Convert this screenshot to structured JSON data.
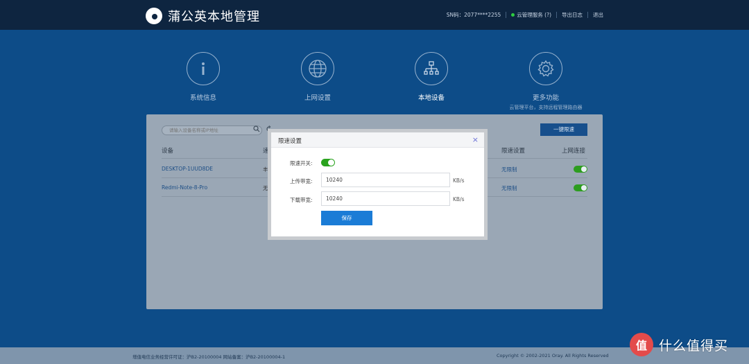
{
  "header": {
    "title": "蒲公英本地管理",
    "sn": "SN码：2077****2255",
    "cloud_status": "云管理服务 (?)",
    "export_log": "导出日志",
    "logout": "退出"
  },
  "nav": {
    "items": [
      {
        "label": "系统信息",
        "icon": "info-icon"
      },
      {
        "label": "上网设置",
        "icon": "globe-icon"
      },
      {
        "label": "本地设备",
        "icon": "network-tree-icon",
        "active": true
      },
      {
        "label": "更多功能",
        "icon": "gear-icon",
        "sub": "云管理平台，支持远程管理路由器"
      }
    ]
  },
  "panel": {
    "search_placeholder": "请输入设备名称或IP地址",
    "one_key_btn": "一键限速",
    "columns": [
      "设备",
      "速",
      "限速设置",
      "上网连接"
    ],
    "rows": [
      {
        "device": "DESKTOP-1UUD8DE",
        "mid": "丰",
        "limit": "无限制",
        "online": true
      },
      {
        "device": "Redmi-Note-8-Pro",
        "mid": "无",
        "limit": "无限制",
        "online": true
      }
    ]
  },
  "modal": {
    "title": "限速设置",
    "switch_label": "限速开关:",
    "switch_on": true,
    "upload_label": "上传带宽:",
    "upload_value": "10240",
    "download_label": "下载带宽:",
    "download_value": "10240",
    "unit": "KB/s",
    "save_label": "保存"
  },
  "footer": {
    "left": "增值电信业务经营许可证：沪B2-20100004 网站备案：沪B2-20100004-1",
    "right": "Copyright © 2002-2021 Oray. All Rights Reserved"
  },
  "watermark": {
    "badge": "值",
    "text": "什么值得买"
  },
  "colors": {
    "header_bg": "#0e2540",
    "main_bg": "#0d4c88",
    "accent": "#1b7cd6",
    "toggle_on": "#2aa31e"
  }
}
